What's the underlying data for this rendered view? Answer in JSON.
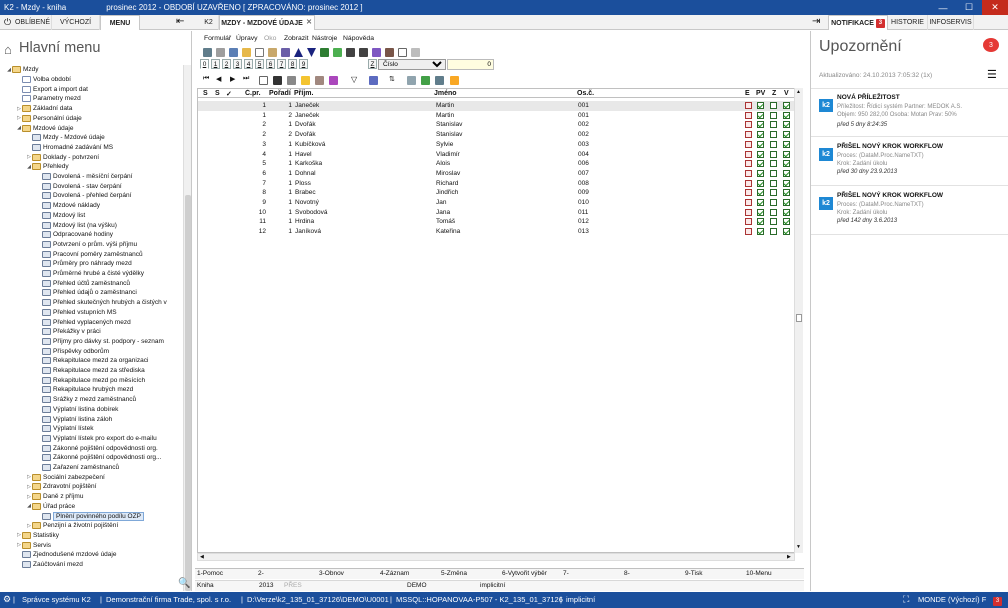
{
  "titlebar": {
    "title": "K2 - Mzdy - kniha",
    "period": "prosinec 2012 - OBDOBÍ UZAVŘENO [ ZPRACOVÁNO: prosinec 2012 ]"
  },
  "tabs": {
    "left": [
      "OBLÍBENÉ",
      "VÝCHOZÍ",
      "MENU"
    ],
    "active_left": "MENU",
    "doc_tabs": [
      "K2",
      "MZDY - MZDOVÉ ÚDAJE"
    ],
    "right": [
      "NOTIFIKACE",
      "HISTORIE",
      "INFOSERVIS"
    ],
    "notif_count": "3"
  },
  "sidebar": {
    "title": "Hlavní menu",
    "tree": [
      {
        "label": "Mzdy",
        "lvl": 0,
        "exp": "open",
        "icon": "fold"
      },
      {
        "label": "Volba období",
        "lvl": 1,
        "icon": "doc"
      },
      {
        "label": "Export a import dat",
        "lvl": 1,
        "icon": "doc"
      },
      {
        "label": "Parametry mezd",
        "lvl": 1,
        "icon": "doc"
      },
      {
        "label": "Základní data",
        "lvl": 1,
        "exp": "closed",
        "icon": "fold"
      },
      {
        "label": "Personální údaje",
        "lvl": 1,
        "exp": "closed",
        "icon": "fold"
      },
      {
        "label": "Mzdové údaje",
        "lvl": 1,
        "exp": "open",
        "icon": "fold"
      },
      {
        "label": "Mzdy - Mzdové údaje",
        "lvl": 2,
        "icon": "win"
      },
      {
        "label": "Hromadné zadávání MS",
        "lvl": 2,
        "icon": "win"
      },
      {
        "label": "Doklady - potvrzení",
        "lvl": 2,
        "exp": "closed",
        "icon": "fold"
      },
      {
        "label": "Přehledy",
        "lvl": 2,
        "exp": "open",
        "icon": "fold"
      },
      {
        "label": "Dovolená - měsíční čerpání",
        "lvl": 3,
        "icon": "win"
      },
      {
        "label": "Dovolená - stav čerpání",
        "lvl": 3,
        "icon": "win"
      },
      {
        "label": "Dovolená - přehled čerpání",
        "lvl": 3,
        "icon": "win"
      },
      {
        "label": "Mzdové náklady",
        "lvl": 3,
        "icon": "win"
      },
      {
        "label": "Mzdový list",
        "lvl": 3,
        "icon": "win"
      },
      {
        "label": "Mzdový list (na výšku)",
        "lvl": 3,
        "icon": "win"
      },
      {
        "label": "Odpracované hodiny",
        "lvl": 3,
        "icon": "win"
      },
      {
        "label": "Potvrzení o prům. výši příjmu",
        "lvl": 3,
        "icon": "win"
      },
      {
        "label": "Pracovní poměry zaměstnanců",
        "lvl": 3,
        "icon": "win"
      },
      {
        "label": "Průměry pro náhrady mezd",
        "lvl": 3,
        "icon": "win"
      },
      {
        "label": "Průměrné hrubé a čisté výdělky",
        "lvl": 3,
        "icon": "win"
      },
      {
        "label": "Přehled účtů zaměstnanců",
        "lvl": 3,
        "icon": "win"
      },
      {
        "label": "Přehled údajů o zaměstnanci",
        "lvl": 3,
        "icon": "win"
      },
      {
        "label": "Přehled skutečných hrubých a čistých v",
        "lvl": 3,
        "icon": "win"
      },
      {
        "label": "Přehled vstupních MS",
        "lvl": 3,
        "icon": "win"
      },
      {
        "label": "Přehled vyplacených mezd",
        "lvl": 3,
        "icon": "win"
      },
      {
        "label": "Překážky v práci",
        "lvl": 3,
        "icon": "win"
      },
      {
        "label": "Příjmy pro dávky st. podpory - seznam",
        "lvl": 3,
        "icon": "win"
      },
      {
        "label": "Příspěvky odborům",
        "lvl": 3,
        "icon": "win"
      },
      {
        "label": "Rekapitulace mezd za organizaci",
        "lvl": 3,
        "icon": "win"
      },
      {
        "label": "Rekapitulace mezd za střediska",
        "lvl": 3,
        "icon": "win"
      },
      {
        "label": "Rekapitulace mezd po měsících",
        "lvl": 3,
        "icon": "win"
      },
      {
        "label": "Rekapitulace hrubých mezd",
        "lvl": 3,
        "icon": "win"
      },
      {
        "label": "Srážky z mezd zaměstnanců",
        "lvl": 3,
        "icon": "win"
      },
      {
        "label": "Výplatní listina dobírek",
        "lvl": 3,
        "icon": "win"
      },
      {
        "label": "Výplatní listina záloh",
        "lvl": 3,
        "icon": "win"
      },
      {
        "label": "Výplatní lístek",
        "lvl": 3,
        "icon": "win"
      },
      {
        "label": "Výplatní lístek pro export do e-mailu",
        "lvl": 3,
        "icon": "win"
      },
      {
        "label": "Zákonné pojištění odpovědnosti org.",
        "lvl": 3,
        "icon": "win"
      },
      {
        "label": "Zákonné pojištění odpovědnosti org...",
        "lvl": 3,
        "icon": "win"
      },
      {
        "label": "Zařazení zaměstnanců",
        "lvl": 3,
        "icon": "win"
      },
      {
        "label": "Sociální zabezpečení",
        "lvl": 2,
        "exp": "closed",
        "icon": "fold"
      },
      {
        "label": "Zdravotní pojištění",
        "lvl": 2,
        "exp": "closed",
        "icon": "fold"
      },
      {
        "label": "Daně z příjmu",
        "lvl": 2,
        "exp": "closed",
        "icon": "fold"
      },
      {
        "label": "Úřad práce",
        "lvl": 2,
        "exp": "open",
        "icon": "fold"
      },
      {
        "label": "Plnění povinného podílu OZP",
        "lvl": 3,
        "icon": "win",
        "sel": true
      },
      {
        "label": "Penzijní a životní pojištění",
        "lvl": 2,
        "exp": "closed",
        "icon": "fold"
      },
      {
        "label": "Statistiky",
        "lvl": 1,
        "exp": "closed",
        "icon": "fold"
      },
      {
        "label": "Servis",
        "lvl": 1,
        "exp": "closed",
        "icon": "fold"
      },
      {
        "label": "Zjednodušené mzdové údaje",
        "lvl": 1,
        "icon": "win"
      },
      {
        "label": "Zaúčtování mezd",
        "lvl": 1,
        "icon": "win"
      }
    ]
  },
  "menubar": [
    {
      "label": "Formulář",
      "dis": false
    },
    {
      "label": "Úpravy",
      "dis": false
    },
    {
      "label": "Oko",
      "dis": true
    },
    {
      "label": "Zobrazit",
      "dis": false
    },
    {
      "label": "Nástroje",
      "dis": false
    },
    {
      "label": "Nápověda",
      "dis": false
    }
  ],
  "numtabs": [
    "0",
    "1",
    "2",
    "3",
    "4",
    "5",
    "6",
    "7",
    "8",
    "9",
    "Z"
  ],
  "field_select": "Číslo",
  "field_value": "0",
  "grid": {
    "headers": [
      "S",
      "S",
      "✓",
      "Č.pr.",
      "Pořadí",
      "Příjm.",
      "Jméno",
      "Os.č.",
      "E",
      "PV",
      "Z",
      "V"
    ],
    "rows": [
      [
        "1",
        "1",
        "Janeček",
        "Martin",
        "001"
      ],
      [
        "1",
        "2",
        "Janeček",
        "Martin",
        "001"
      ],
      [
        "2",
        "1",
        "Dvořák",
        "Stanislav",
        "002"
      ],
      [
        "2",
        "2",
        "Dvořák",
        "Stanislav",
        "002"
      ],
      [
        "3",
        "1",
        "Kubíčková",
        "Sylvie",
        "003"
      ],
      [
        "4",
        "1",
        "Havel",
        "Vladimír",
        "004"
      ],
      [
        "5",
        "1",
        "Karkoška",
        "Alois",
        "006"
      ],
      [
        "6",
        "1",
        "Dohnal",
        "Miroslav",
        "007"
      ],
      [
        "7",
        "1",
        "Ploss",
        "Richard",
        "008"
      ],
      [
        "8",
        "1",
        "Brabec",
        "Jindřich",
        "009"
      ],
      [
        "9",
        "1",
        "Novotný",
        "Jan",
        "010"
      ],
      [
        "10",
        "1",
        "Svobodová",
        "Jana",
        "011"
      ],
      [
        "11",
        "1",
        "Hrdina",
        "Tomáš",
        "012"
      ],
      [
        "12",
        "1",
        "Janíková",
        "Kateřina",
        "013"
      ]
    ]
  },
  "fkeys": [
    "1-Pomoc",
    "2-",
    "3-Obnov",
    "4-Záznam",
    "5-Změna",
    "6-Vytvořit výběr",
    "7-",
    "8-",
    "9-Tisk",
    "10-Menu"
  ],
  "statusrow": [
    "Kniha",
    "2013",
    "PŘES",
    "DEMO",
    "implicitní"
  ],
  "notifications": {
    "title": "Upozornění",
    "count": "3",
    "updated": "Aktualizováno: 24.10.2013 7:05:32 (1x)",
    "items": [
      {
        "title": "NOVÁ PŘÍLEŽITOST",
        "line1": "Příležitost: Řídicí systém Partner: MEDOK A.S.",
        "line2": "Objem: 950 282,00 Osoba: Motan Prav: 50%",
        "date": "před 5 dny 8:24:35"
      },
      {
        "title": "PŘIŠEL NOVÝ KROK WORKFLOW",
        "line1": "Proces: (DataM.Proc.NameTXT)",
        "line2": "Krok: Zadání úkolu",
        "date": "před 30 dny 23.9.2013"
      },
      {
        "title": "PŘIŠEL NOVÝ KROK WORKFLOW",
        "line1": "Proces: (DataM.Proc.NameTXT)",
        "line2": "Krok: Zadání úkolu",
        "date": "před 142 dny 3.6.2013"
      }
    ]
  },
  "bottombar": {
    "user": "Správce systému K2",
    "company": "Demonstrační firma Trade, spol. s r.o.",
    "path": "D:\\Verze\\k2_135_01_37126\\DEMO\\U0001",
    "db": "MSSQL::HOPANOVAA-P507 - K2_135_01_37126",
    "mode": "implicitní",
    "theme": "MONDE (Výchozí) F",
    "badge": "3"
  }
}
